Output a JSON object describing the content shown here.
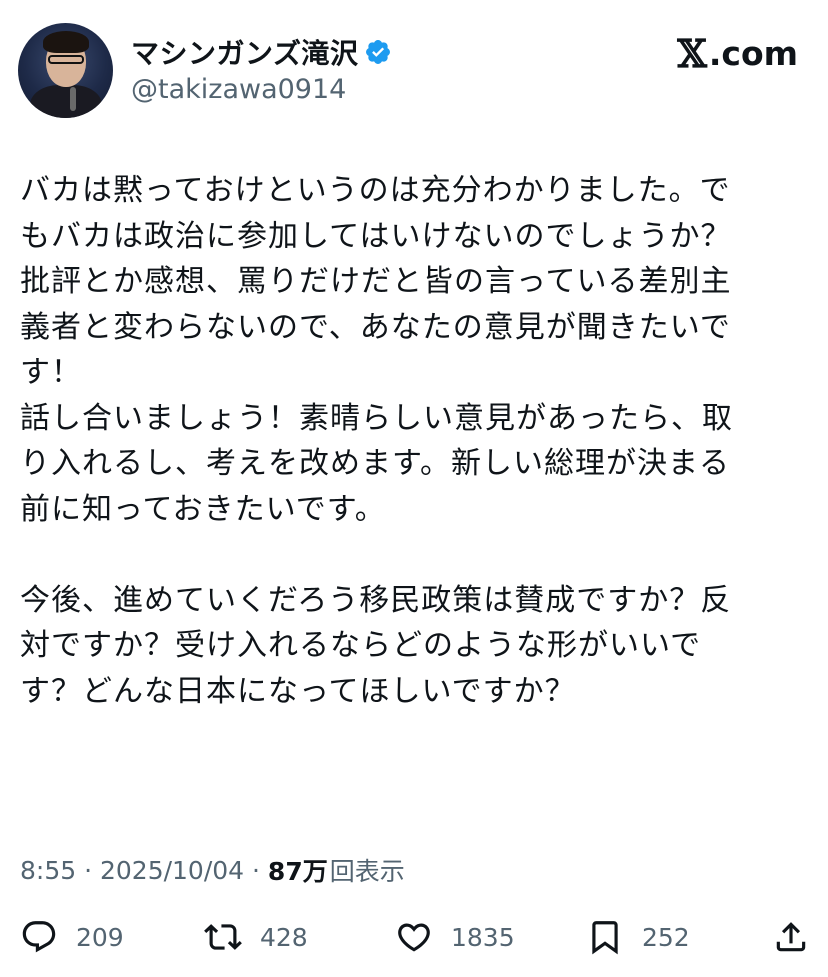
{
  "user": {
    "display_name": "マシンガンズ滝沢",
    "handle": "@takizawa0914",
    "verified": true
  },
  "site": {
    "logo_mark": "𝕏",
    "logo_text": ".com"
  },
  "tweet": {
    "lines": [
      "バカは黙っておけというのは充分わかりました。で",
      "もバカは政治に参加してはいけないのでしょうか？",
      "批評とか感想、罵りだけだと皆の言っている差別主",
      "義者と変わらないので、あなたの意見が聞きたいで",
      "す！",
      "話し合いましょう！素晴らしい意見があったら、取",
      "り入れるし、考えを改めます。新しい総理が決まる",
      "前に知っておきたいです。",
      "",
      "今後、進めていくだろう移民政策は賛成ですか？反",
      "対ですか？受け入れるならどのような形がいいで",
      "す？どんな日本になってほしいですか？"
    ]
  },
  "meta": {
    "time": "8:55",
    "separator": " · ",
    "date": "2025/10/04",
    "views_count": "87万",
    "views_label": "回表示"
  },
  "actions": {
    "replies": "209",
    "reposts": "428",
    "likes": "1835",
    "bookmarks": "252"
  },
  "colors": {
    "text": "#0f1419",
    "secondary": "#536471",
    "verified_badge": "#1d9bf0"
  }
}
